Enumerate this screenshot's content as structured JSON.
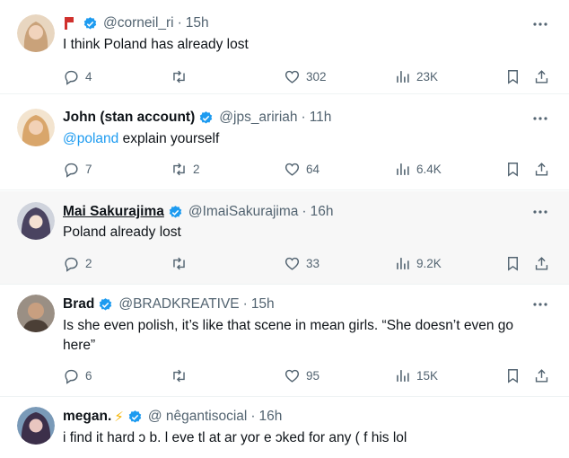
{
  "tweets": [
    {
      "name": "",
      "handle": "@corneil_ri",
      "time": "15h",
      "text": "I think Poland has already lost",
      "replies": "4",
      "retweets": "",
      "likes": "302",
      "views": "23K",
      "avatar_color": "#c9a27a"
    },
    {
      "name": "John (stan account)",
      "handle": "@jps_aririah",
      "time": "11h",
      "mention": "@poland",
      "text": " explain yourself",
      "replies": "7",
      "retweets": "2",
      "likes": "64",
      "views": "6.4K",
      "avatar_color": "#d9a66b"
    },
    {
      "name": "Mai Sakurajima",
      "handle": "@ImaiSakurajima",
      "time": "16h",
      "text": "Poland already lost",
      "replies": "2",
      "retweets": "",
      "likes": "33",
      "views": "9.2K",
      "avatar_color": "#4a4360"
    },
    {
      "name": "Brad",
      "handle": "@BRADKREATIVE",
      "time": "15h",
      "text": "Is she even polish, it’s like that scene in mean girls. “She doesn’t even go here”",
      "replies": "6",
      "retweets": "",
      "likes": "95",
      "views": "15K",
      "avatar_color": "#6b5a4a"
    },
    {
      "name": "megan.",
      "emoji": "⚡",
      "handle": "@ nêgantisocial",
      "time": "16h",
      "text": "i find it hard  ɔ b. l eve tl at ar yor e  ɔked for any ( f  his lol",
      "avatar_color": "#3c2f4a"
    }
  ],
  "colors": {
    "accent": "#1d9bf0",
    "muted": "#536471",
    "verified": "#1d9bf0"
  }
}
